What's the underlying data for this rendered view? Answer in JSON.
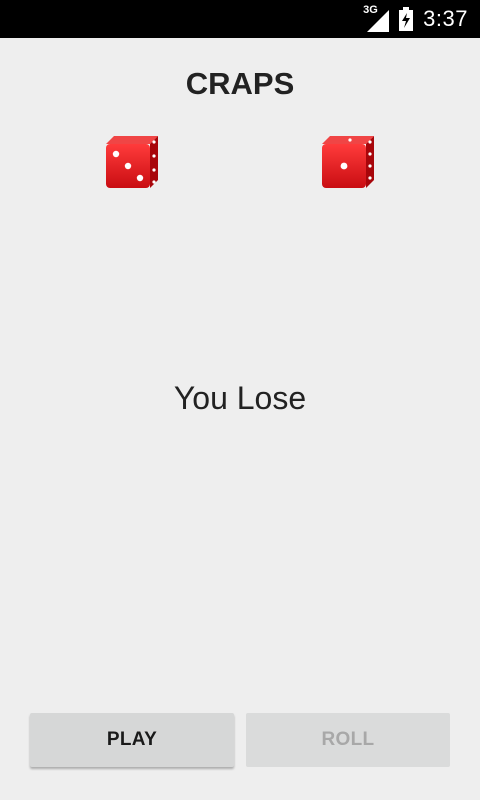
{
  "status_bar": {
    "network": "3G",
    "time": "3:37"
  },
  "title": "CRAPS",
  "dice": [
    {
      "label": "die-left",
      "face": 3
    },
    {
      "label": "die-right",
      "face": 1
    }
  ],
  "result_text": "You Lose",
  "buttons": {
    "play": "PLAY",
    "roll": "ROLL"
  },
  "colors": {
    "background": "#eeeeee",
    "die_red": "#e0141b",
    "button": "#d6d7d7"
  }
}
